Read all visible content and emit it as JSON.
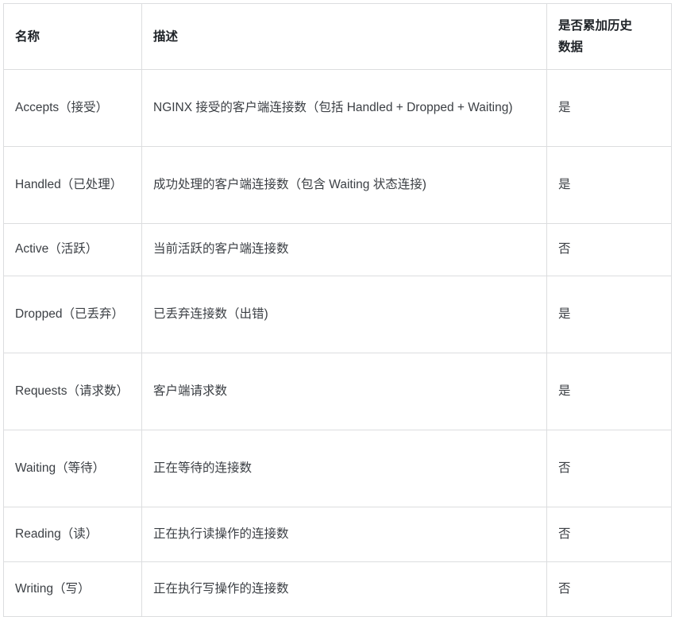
{
  "table": {
    "columns": [
      {
        "key": "name",
        "label": "名称"
      },
      {
        "key": "desc",
        "label": "描述"
      },
      {
        "key": "cumulative",
        "label": "是否累加历史\n数据"
      }
    ],
    "headers": {
      "name": "名称",
      "desc": "描述",
      "cumulative_line1": "是否累加历史",
      "cumulative_line2": "数据"
    },
    "rows": [
      {
        "name": "Accepts（接受）",
        "desc": "NGINX 接受的客户端连接数（包括 Handled + Dropped + Waiting)",
        "cumulative": "是"
      },
      {
        "name": "Handled（已处理）",
        "desc": "成功处理的客户端连接数（包含 Waiting 状态连接)",
        "cumulative": "是"
      },
      {
        "name": "Active（活跃）",
        "desc": "当前活跃的客户端连接数",
        "cumulative": "否"
      },
      {
        "name": "Dropped（已丢弃）",
        "desc": "已丢弃连接数（出错)",
        "cumulative": "是"
      },
      {
        "name": "Requests（请求数）",
        "desc": "客户端请求数",
        "cumulative": "是"
      },
      {
        "name": "Waiting（等待）",
        "desc": "正在等待的连接数",
        "cumulative": "否"
      },
      {
        "name": "Reading（读）",
        "desc": "正在执行读操作的连接数",
        "cumulative": "否"
      },
      {
        "name": "Writing（写）",
        "desc": "正在执行写操作的连接数",
        "cumulative": "否"
      }
    ]
  },
  "colors": {
    "border": "#dcdddf",
    "header_text": "#1f2328",
    "body_text": "#3b3f44",
    "background": "#ffffff"
  }
}
